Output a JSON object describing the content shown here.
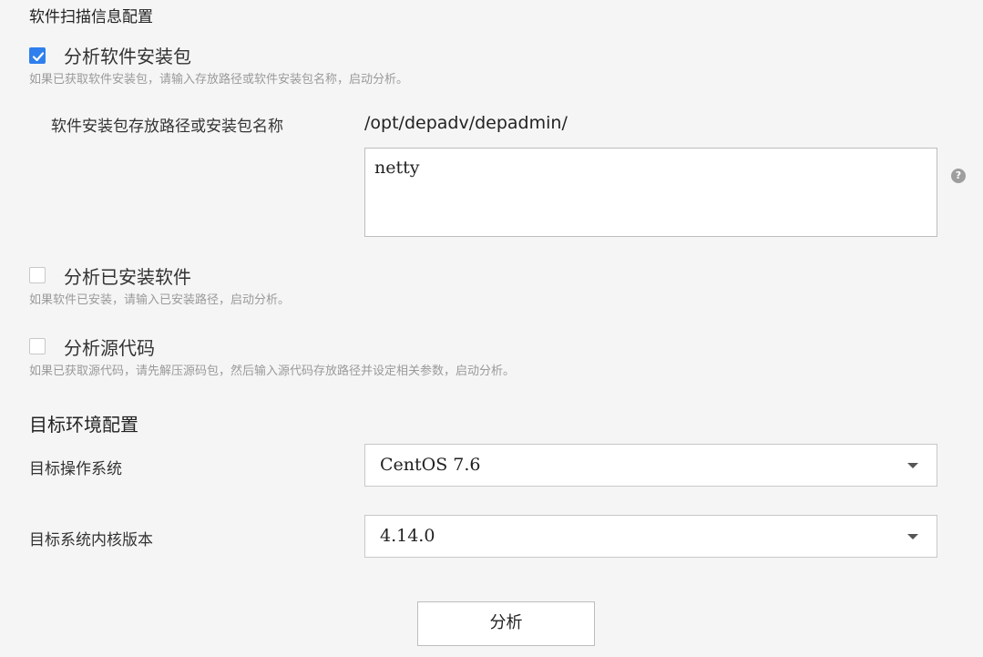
{
  "scan_section": {
    "title": "软件扫描信息配置",
    "options": [
      {
        "label": "分析软件安装包",
        "checked": true,
        "hint": "如果已获取软件安装包，请输入存放路径或软件安装包名称，启动分析。"
      },
      {
        "label": "分析已安装软件",
        "checked": false,
        "hint": "如果软件已安装，请输入已安装路径，启动分析。"
      },
      {
        "label": "分析源代码",
        "checked": false,
        "hint": "如果已获取源代码，请先解压源码包，然后输入源代码存放路径并设定相关参数，启动分析。"
      }
    ],
    "package_path": {
      "label": "软件安装包存放路径或安装包名称",
      "base_path": "/opt/depadv/depadmin/",
      "value": "netty",
      "help_icon": "question-circle-icon"
    }
  },
  "target_section": {
    "title": "目标环境配置",
    "os": {
      "label": "目标操作系统",
      "value": "CentOS 7.6",
      "icon": "chevron-down-icon"
    },
    "kernel": {
      "label": "目标系统内核版本",
      "value": "4.14.0",
      "icon": "chevron-down-icon"
    }
  },
  "actions": {
    "analyze_label": "分析"
  },
  "colors": {
    "accent": "#2f80ed",
    "background": "#f5f5f5",
    "hint": "#9a9a9a"
  }
}
